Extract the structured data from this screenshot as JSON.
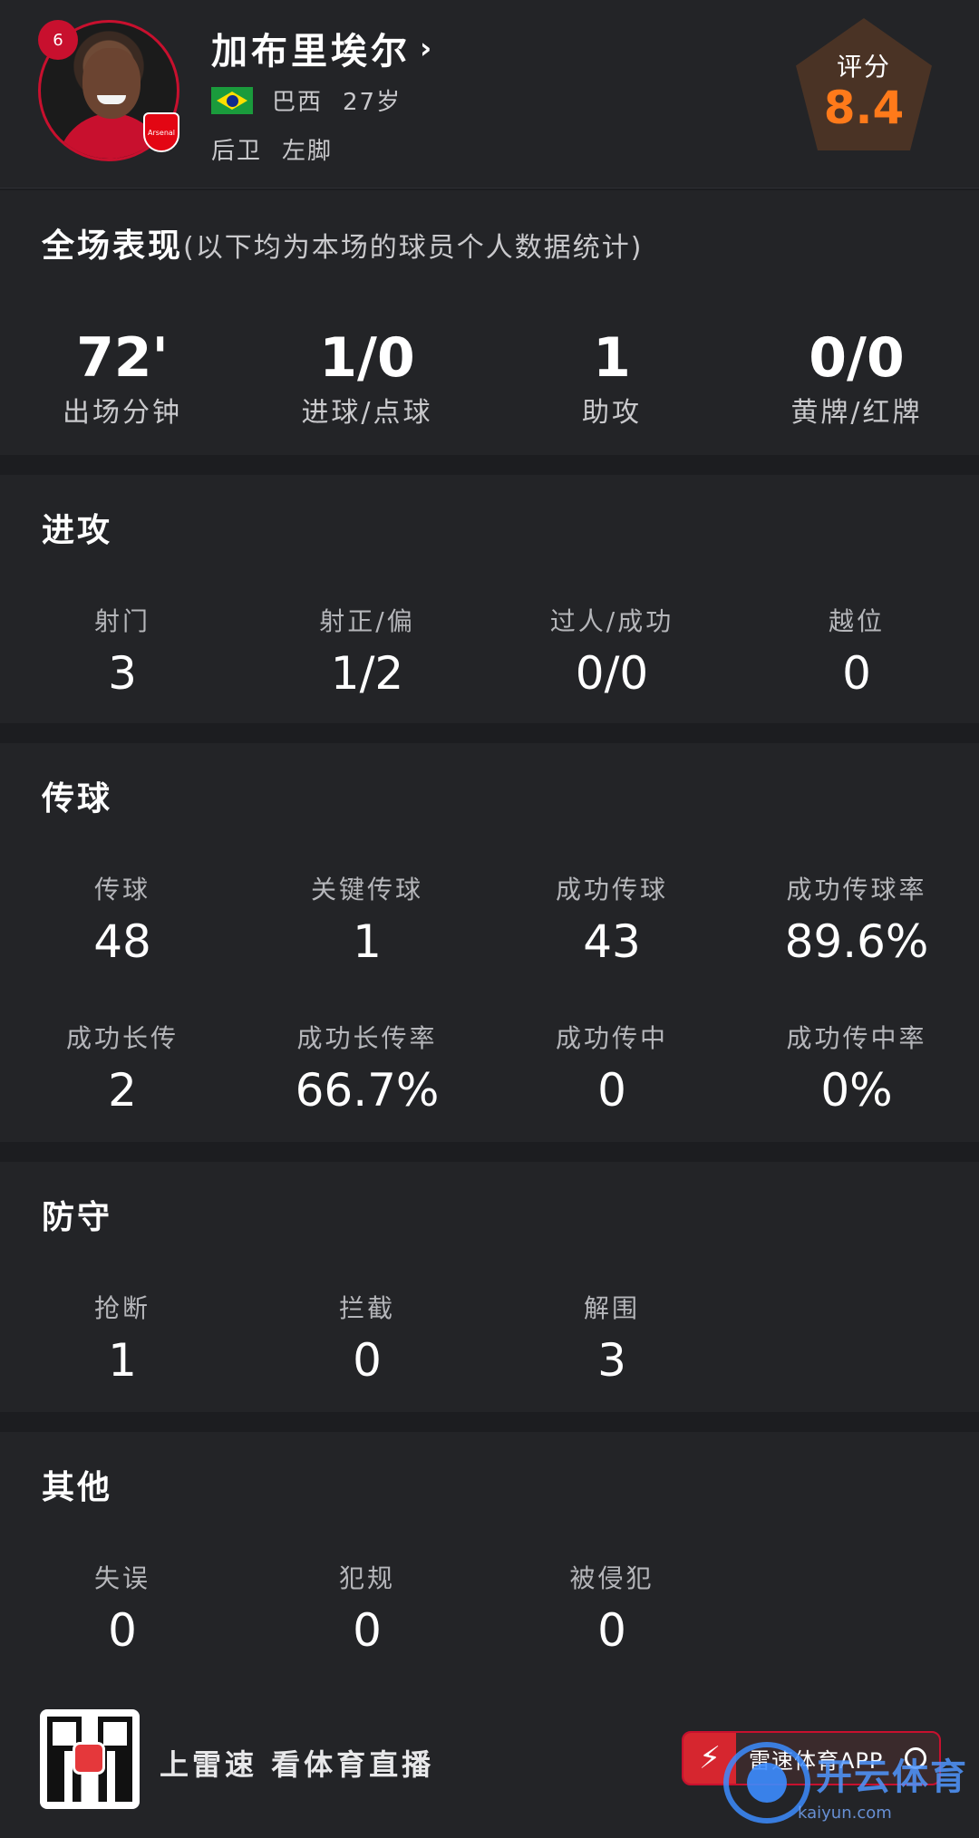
{
  "player": {
    "number": "6",
    "name": "加布里埃尔",
    "nationality": "巴西",
    "age": "27岁",
    "position": "后卫",
    "foot": "左脚",
    "club_badge_text": "Arsenal"
  },
  "rating": {
    "label": "评分",
    "value": "8.4",
    "color": "#ff7a1a"
  },
  "overall": {
    "title": "全场表现",
    "subtitle": "(以下均为本场的球员个人数据统计)",
    "stats": [
      {
        "value": "72'",
        "label": "出场分钟"
      },
      {
        "value": "1/0",
        "label": "进球/点球"
      },
      {
        "value": "1",
        "label": "助攻"
      },
      {
        "value": "0/0",
        "label": "黄牌/红牌"
      }
    ]
  },
  "attack": {
    "title": "进攻",
    "stats": [
      {
        "label": "射门",
        "value": "3"
      },
      {
        "label": "射正/偏",
        "value": "1/2"
      },
      {
        "label": "过人/成功",
        "value": "0/0"
      },
      {
        "label": "越位",
        "value": "0"
      }
    ]
  },
  "passing": {
    "title": "传球",
    "stats": [
      {
        "label": "传球",
        "value": "48"
      },
      {
        "label": "关键传球",
        "value": "1"
      },
      {
        "label": "成功传球",
        "value": "43"
      },
      {
        "label": "成功传球率",
        "value": "89.6%"
      },
      {
        "label": "成功长传",
        "value": "2"
      },
      {
        "label": "成功长传率",
        "value": "66.7%"
      },
      {
        "label": "成功传中",
        "value": "0"
      },
      {
        "label": "成功传中率",
        "value": "0%"
      }
    ]
  },
  "defense": {
    "title": "防守",
    "stats": [
      {
        "label": "抢断",
        "value": "1"
      },
      {
        "label": "拦截",
        "value": "0"
      },
      {
        "label": "解围",
        "value": "3"
      }
    ]
  },
  "other": {
    "title": "其他",
    "stats": [
      {
        "label": "失误",
        "value": "0"
      },
      {
        "label": "犯规",
        "value": "0"
      },
      {
        "label": "被侵犯",
        "value": "0"
      }
    ]
  },
  "footer": {
    "slogan": "上雷速 看体育直播",
    "app_button": "雷速体育APP",
    "watermark": "开云体育",
    "watermark_sub": "kaiyun.com"
  }
}
